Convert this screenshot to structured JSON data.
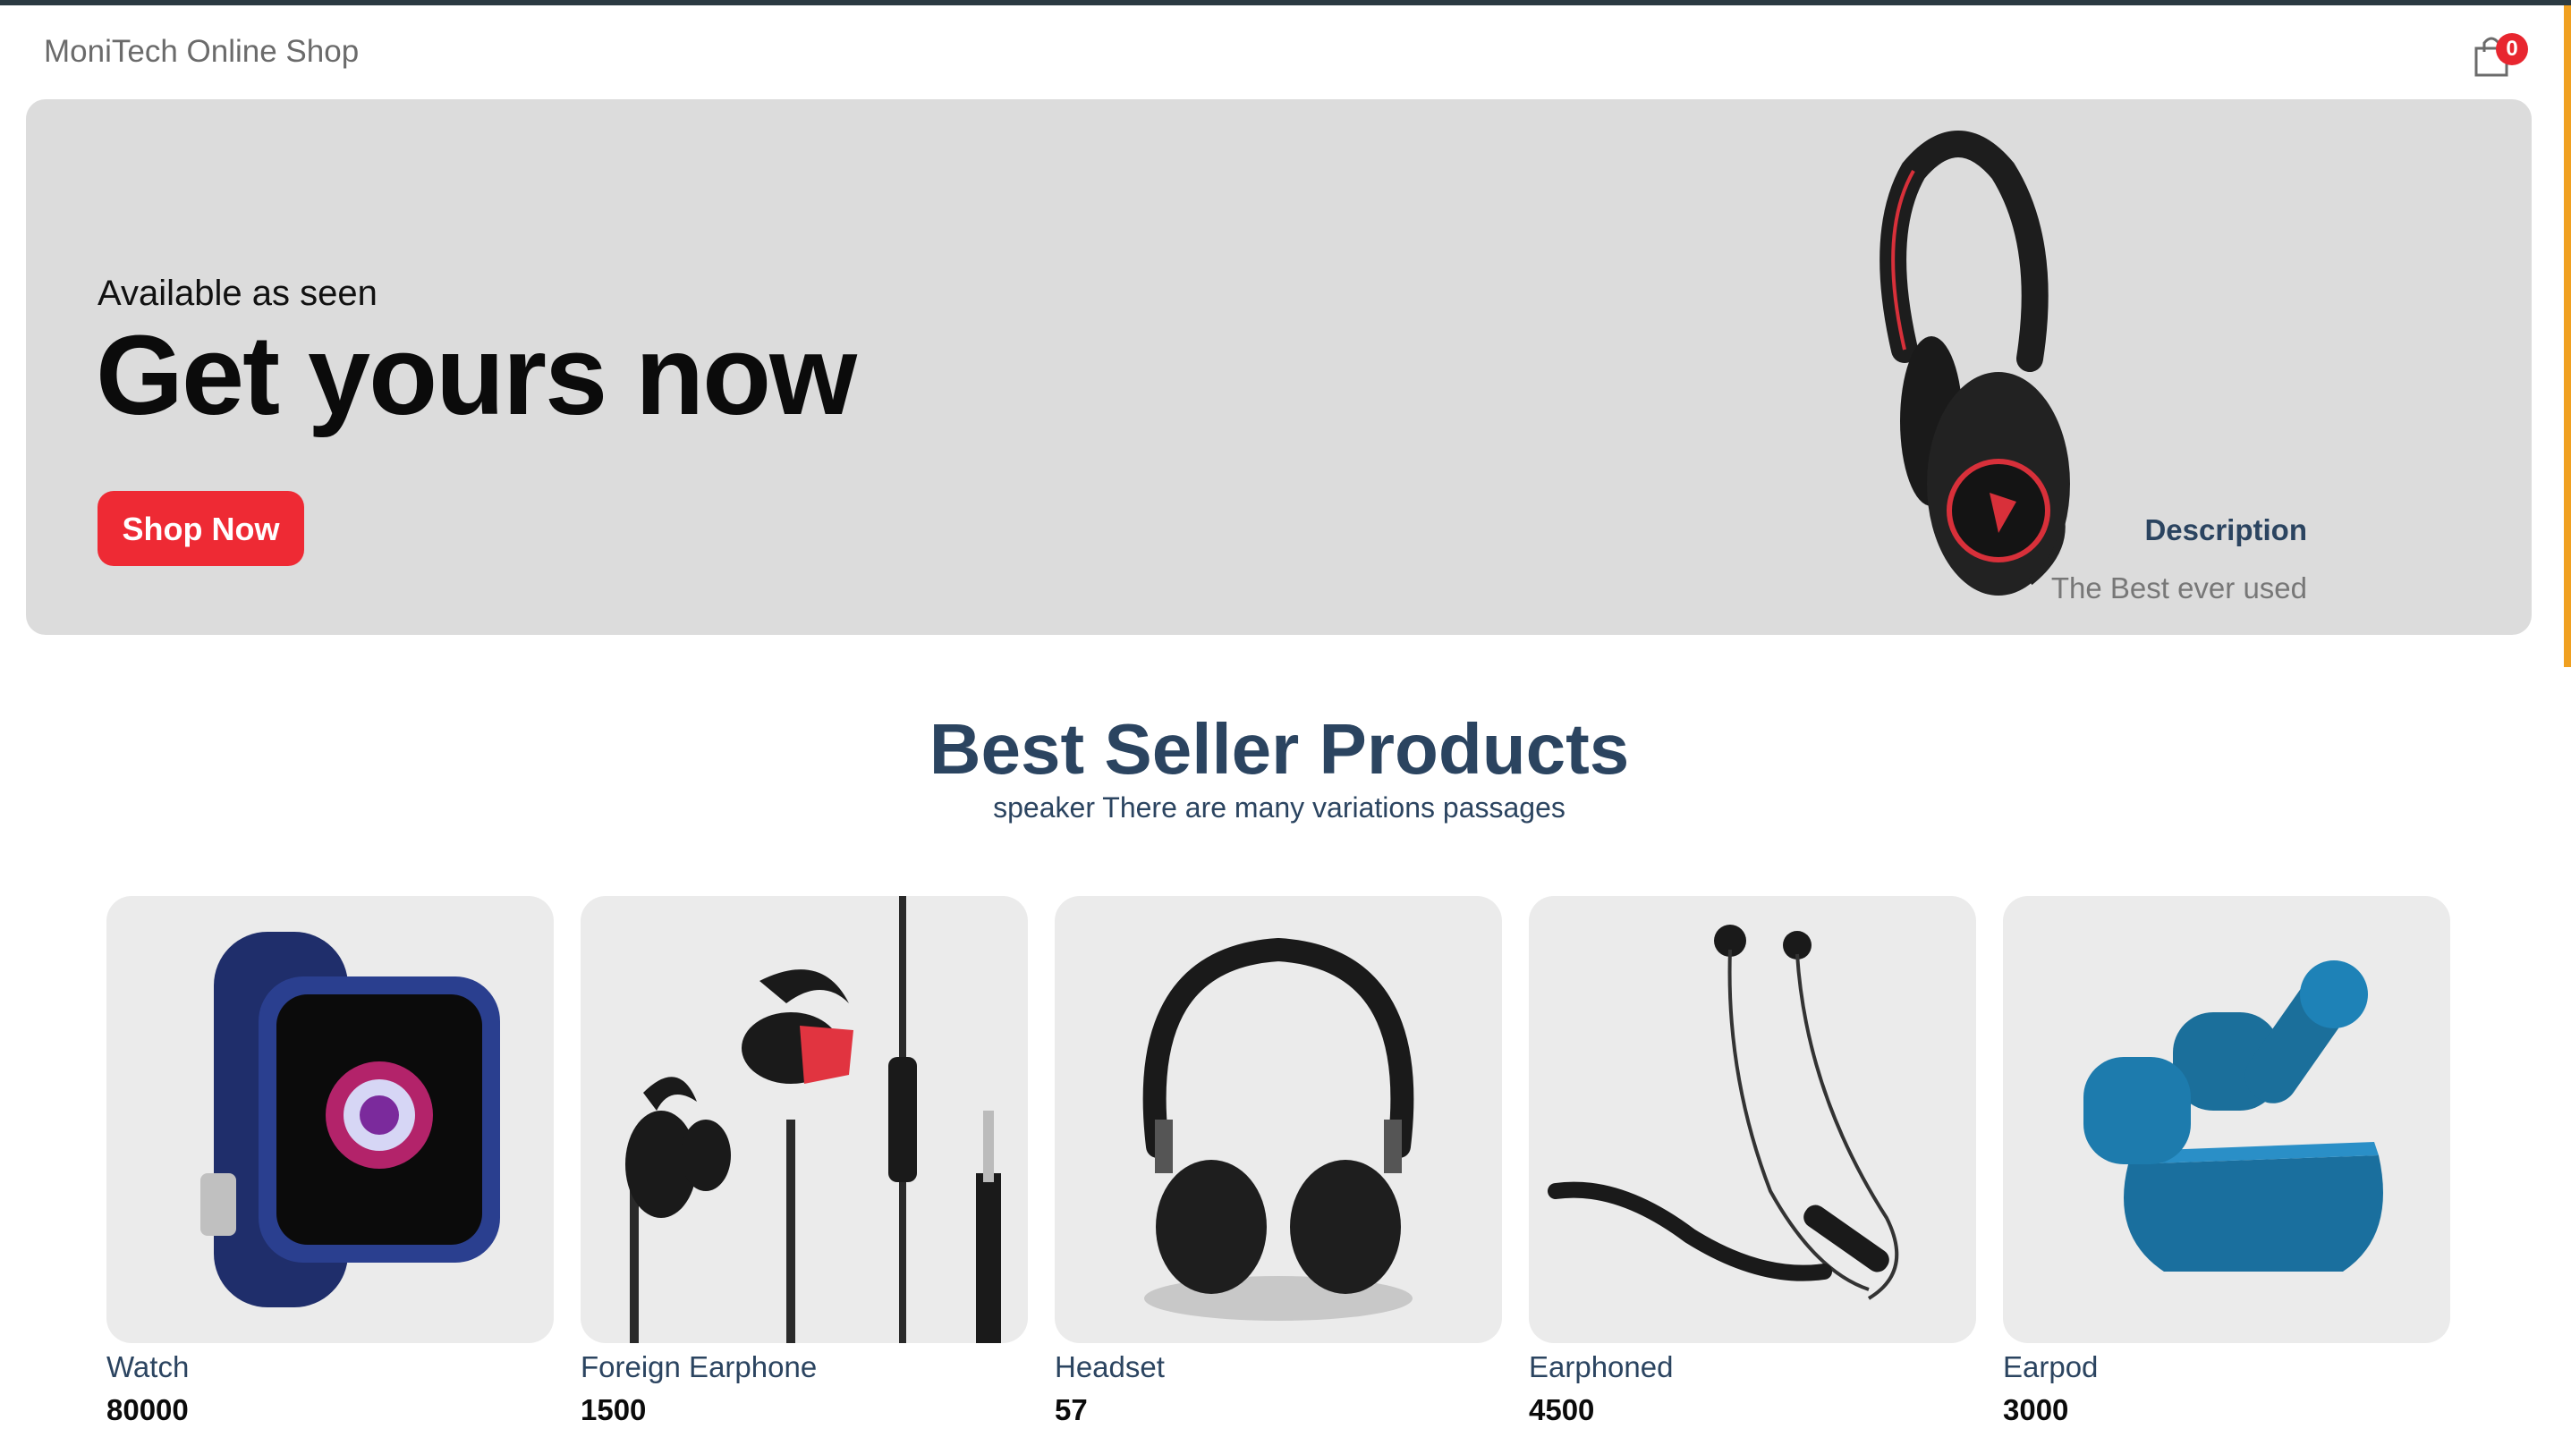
{
  "navbar": {
    "brand": "MoniTech Online Shop",
    "cart_count": "0"
  },
  "hero": {
    "subtitle": "Available as seen",
    "title": "Get yours now",
    "button_label": "Shop Now",
    "description_title": "Description",
    "description_text": "The Best ever used"
  },
  "best_seller": {
    "title": "Best Seller Products",
    "subtitle": "speaker There are many variations passages",
    "products": [
      {
        "name": "Watch",
        "price": "80000"
      },
      {
        "name": "Foreign Earphone",
        "price": "1500"
      },
      {
        "name": "Headset",
        "price": "57"
      },
      {
        "name": "Earphoned",
        "price": "4500"
      },
      {
        "name": "Earpod",
        "price": "3000"
      }
    ]
  },
  "icons": {
    "cart": "shopping-bag-icon"
  },
  "colors": {
    "accent_red": "#ee2a34",
    "heading_blue": "#2b4460",
    "hero_bg": "#dcdcdc",
    "card_bg": "#ebebeb",
    "scroll_accent": "#f0a020"
  }
}
